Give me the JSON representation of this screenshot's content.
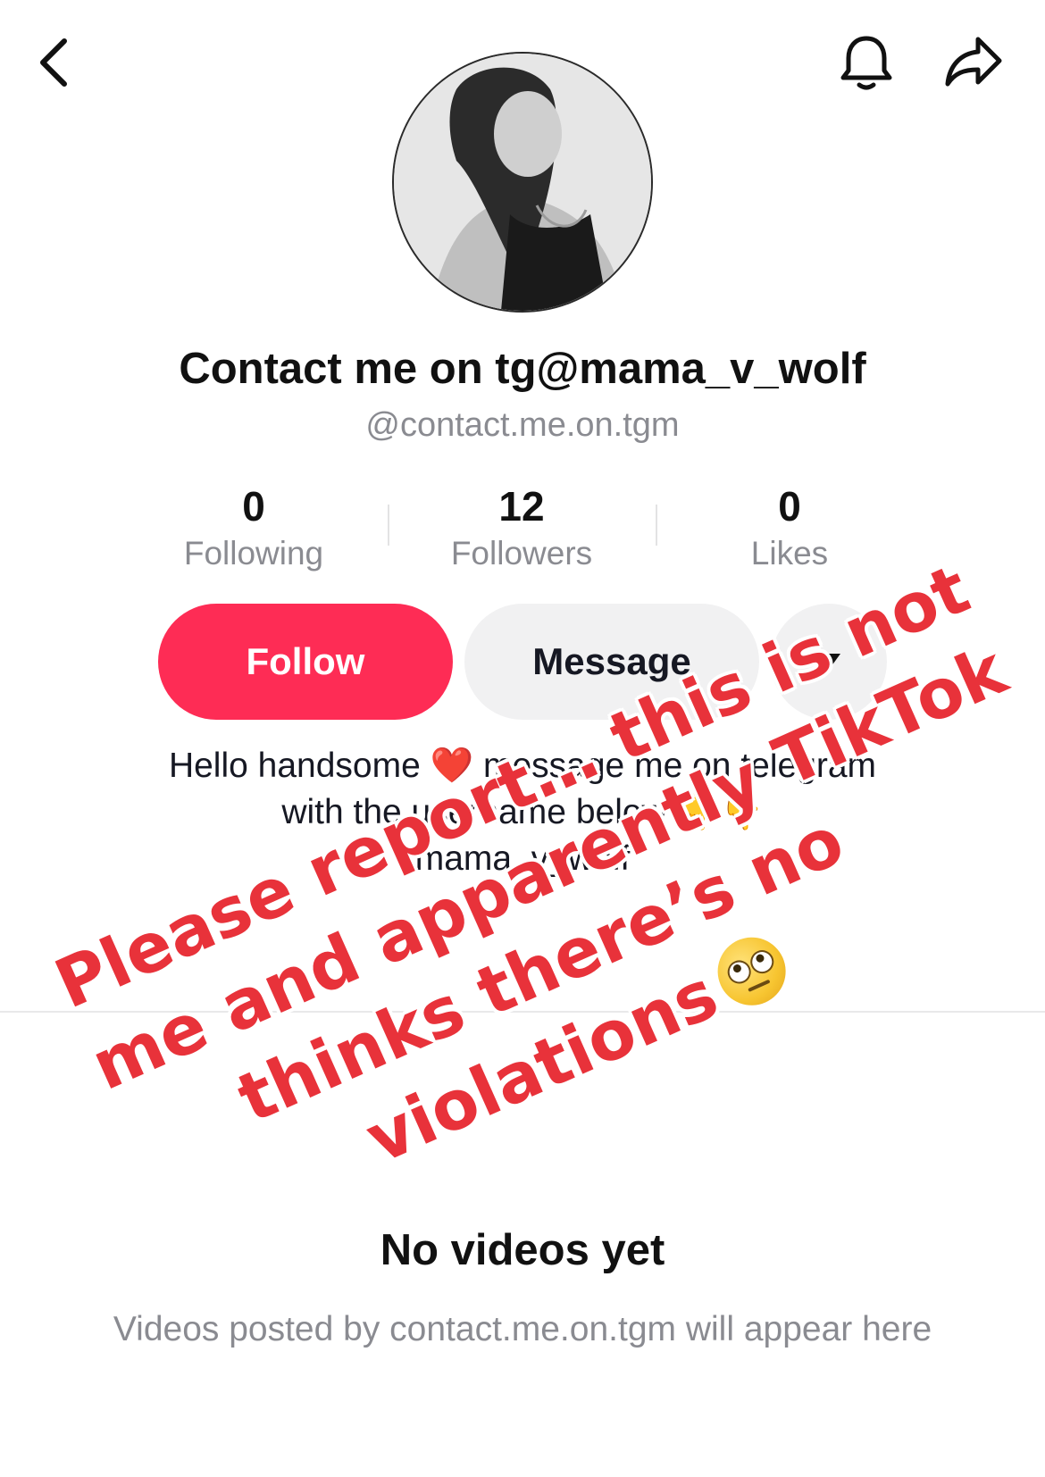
{
  "header": {
    "back_icon": "chevron-left-icon",
    "bell_icon": "bell-icon",
    "share_icon": "share-arrow-icon"
  },
  "profile": {
    "display_name": "Contact me on tg@mama_v_wolf",
    "handle": "@contact.me.on.tgm"
  },
  "stats": [
    {
      "value": "0",
      "label": "Following"
    },
    {
      "value": "12",
      "label": "Followers"
    },
    {
      "value": "0",
      "label": "Likes"
    }
  ],
  "actions": {
    "follow_label": "Follow",
    "message_label": "Message",
    "more_icon": "caret-down-icon"
  },
  "bio": {
    "line1": "Hello handsome ❤️ message me on telegram",
    "line2": "with the username below 👇👇",
    "line3": "mama_v_wolf"
  },
  "empty_state": {
    "title": "No videos yet",
    "subtitle": "Videos posted by contact.me.on.tgm will appear here"
  },
  "overlay_caption": {
    "line1": "Please report… this is not",
    "line2": "me and apparently TikTok",
    "line3": "thinks there’s no",
    "line4": "violations"
  },
  "colors": {
    "follow": "#fe2c55",
    "message_bg": "#f1f1f2",
    "muted_text": "#8a8b91",
    "overlay_text": "#e8323a"
  }
}
